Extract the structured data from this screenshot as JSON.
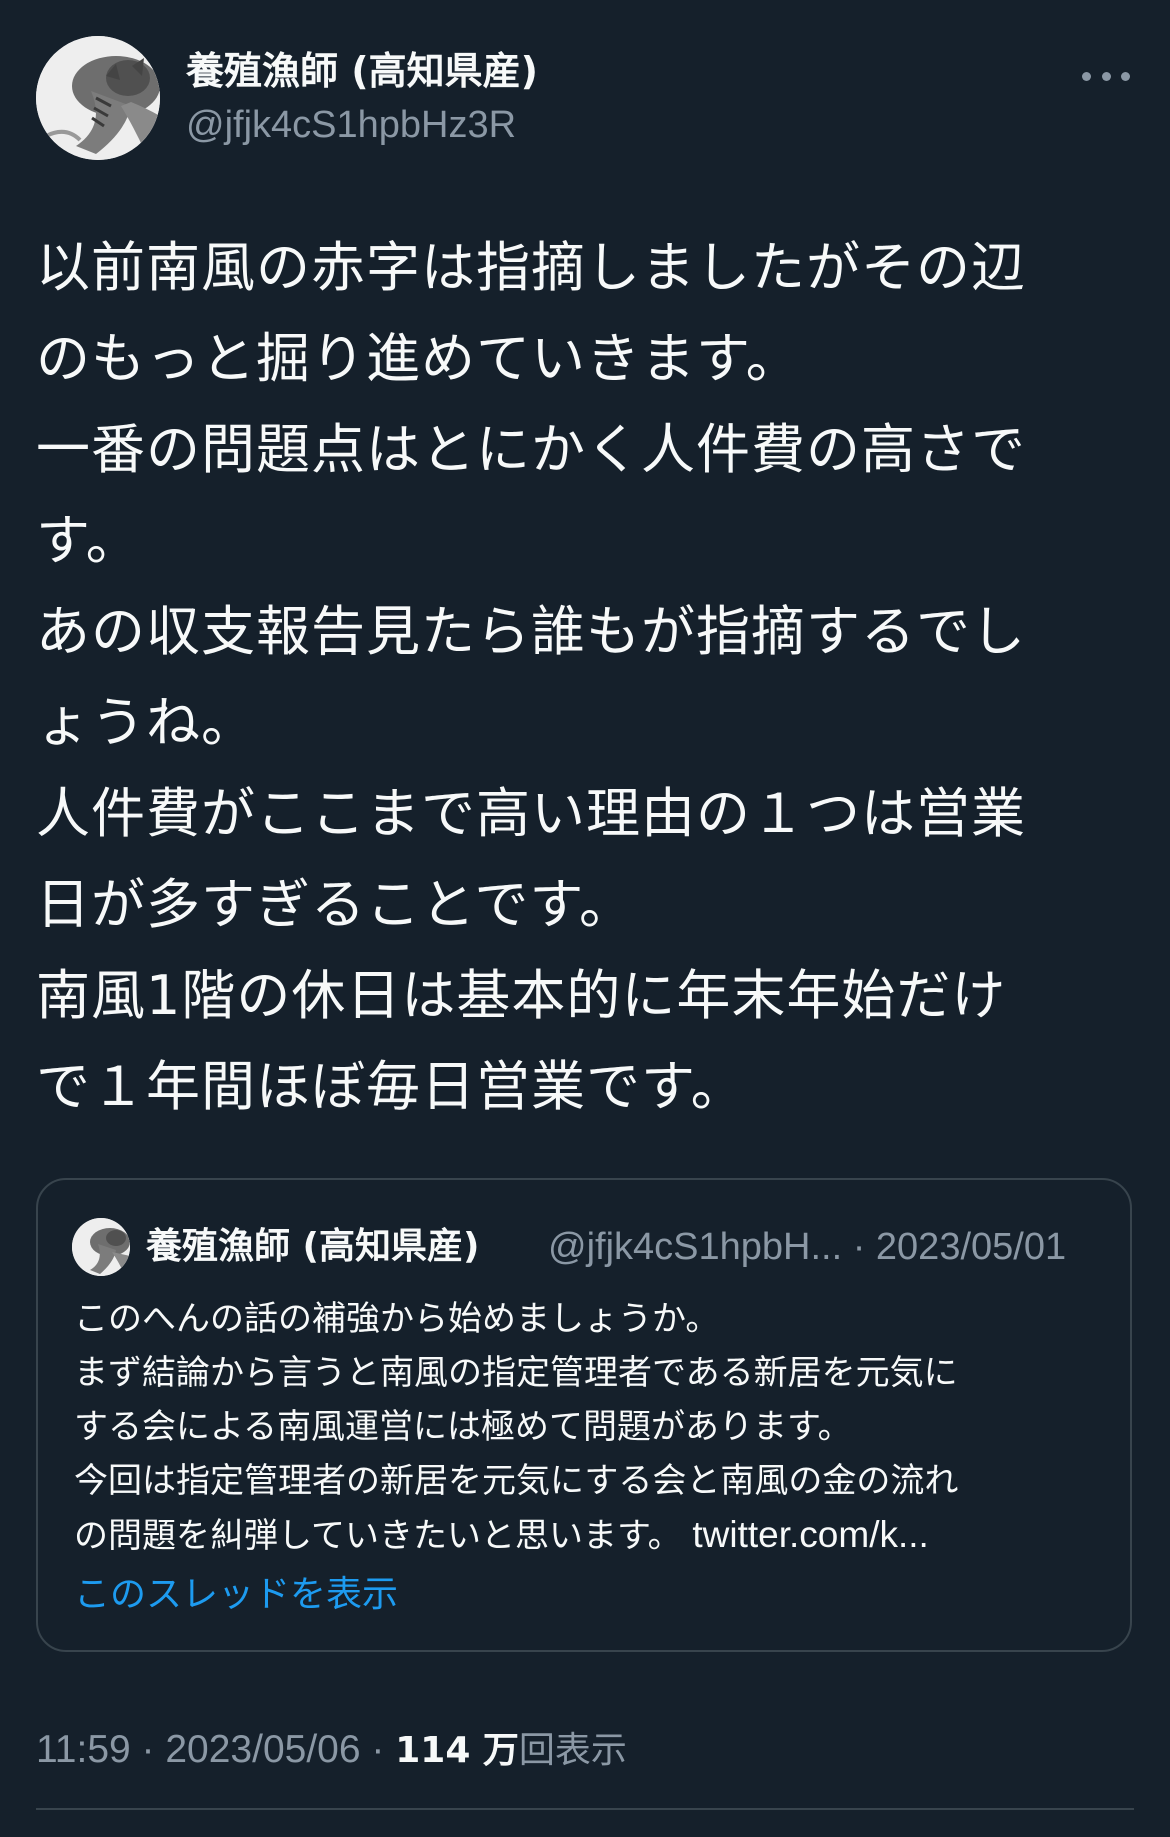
{
  "author": {
    "display_name": "養殖漁師 (高知県産)",
    "handle": "@jfjk4cS1hpbHz3R",
    "avatar_icon": "cat-avatar-icon"
  },
  "more_icon": "more-options-icon",
  "tweet": {
    "lines": [
      "以前南風の赤字は指摘しましたがその辺",
      "のもっと掘り進めていきます。",
      "一番の問題点はとにかく人件費の高さで",
      "す。",
      "あの収支報告見たら誰もが指摘するでし",
      "ょうね。",
      "人件費がここまで高い理由の１つは営業",
      "日が多すぎることです。",
      "南風1階の休日は基本的に年末年始だけ",
      "で１年間ほぼ毎日営業です。"
    ]
  },
  "quoted_tweet": {
    "display_name": "養殖漁師 (高知県産)",
    "handle_date": "@jfjk4cS1hpbH... · 2023/05/01",
    "lines": [
      "このへんの話の補強から始めましょうか。",
      "まず結論から言うと南風の指定管理者である新居を元気に",
      "する会による南風運営には極めて問題があります。",
      "今回は指定管理者の新居を元気にする会と南風の金の流れ"
    ],
    "last_line_text": "の問題を糾弾していきたいと思います。 ",
    "last_line_link": "twitter.com/k...",
    "show_thread": "このスレッドを表示"
  },
  "meta": {
    "time_date": "11:59 · 2023/05/06 · ",
    "views_count": "114 万",
    "views_label": "回表示"
  },
  "colors": {
    "background": "#15202b",
    "text": "#f7f9f9",
    "secondary": "#8b98a5",
    "link": "#1d9bf0",
    "border": "#38444d"
  }
}
